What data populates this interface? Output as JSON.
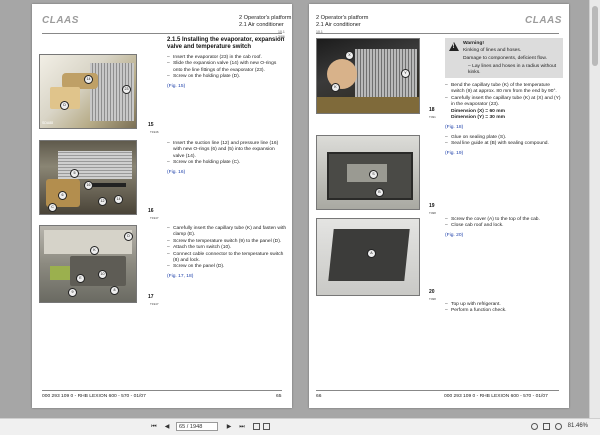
{
  "left_page": {
    "logo": "CLAAS",
    "header_line1": "2 Operator's platform",
    "header_line2": "2.1 Air conditioner",
    "header_small": "10.1",
    "header_small2": "3/86",
    "section_title": "2.1.5 Installing the evaporator, expansion valve and temperature switch",
    "block1": [
      "Insert the evaporator (23) in the cab roof.",
      "Slide the expansion valve (14) with new O-rings onto the line fittings of the evaporator (23).",
      "Screw on the holding plate (D)."
    ],
    "block1_ref": "(Fig. 15)",
    "block2": [
      "Insert the suction line (12) and pressure line (16) with new O-rings (6) and (5) into the expansion valve (14).",
      "Screw on the holding plate (C)."
    ],
    "block2_ref": "(Fig. 16)",
    "block3": [
      "Carefully insert the capillary tube (K) and fasten with clamp (E).",
      "Screw the temperature switch (9) to the panel (D).",
      "Attach the turn switch (10).",
      "Connect cable connector to the temperature switch (8) and lock.",
      "Screw on the panel (D)."
    ],
    "block3_ref": "(Fig. 17, 18)",
    "fig1_no": "15",
    "fig2_no": "16",
    "fig3_no": "17",
    "fig1_code": "T1946",
    "fig2_code": "T1947",
    "fig3_code": "T1947",
    "photo_tag": "SDA88",
    "footer_left": "000 293 109 0 - RHB LEXION 600 - 570 - 01/07",
    "footer_right": "65"
  },
  "right_page": {
    "logo": "CLAAS",
    "header_line1": "2 Operator's platform",
    "header_line2": "2.1 Air conditioner",
    "header_small": "10.1",
    "warning_title": "Warning!",
    "warning_line1": "Kinking of lines and hoses.",
    "warning_line2": "Damage to components, deficient flow.",
    "warning_item": "Lay lines and hoses in a radius without kinks.",
    "block1": [
      "Bend the capillary tube (K) of the temperature switch (9) at approx. 80 mm from the end by 90°.",
      "Carefully insert the capillary tube (K) at (X) and (Y) in the evaporator (23)."
    ],
    "dim_x": "Dimension (X) = 60 mm",
    "dim_y": "Dimension (Y) = 30 mm",
    "block1_ref": "(Fig. 18)",
    "block2": [
      "Glue on sealing plate (S).",
      "Seal line guide at (B) with sealing compound."
    ],
    "block2_ref": "(Fig. 19)",
    "block3": [
      "Screw the cover (A) to the top of the cab.",
      "Close cab roof and lock."
    ],
    "block3_ref": "(Fig. 20)",
    "block4": [
      "Top up with refrigerant.",
      "Perform a function check."
    ],
    "fig1_no": "18",
    "fig2_no": "19",
    "fig3_no": "20",
    "fig1_code": "T491",
    "fig2_code": "T498",
    "fig3_code": "T498",
    "footer_left": "66",
    "footer_right": "000 293 109 0 - RHB LEXION 600 - 570 - 01/07"
  },
  "callouts": {
    "f15": [
      "14",
      "23",
      "D"
    ],
    "f16": [
      "16",
      "12",
      "5",
      "6",
      "14",
      "C"
    ],
    "f17": [
      "D",
      "K",
      "10",
      "E",
      "9",
      "8"
    ],
    "f18": [
      "X",
      "Y",
      "K"
    ],
    "f19": [
      "S",
      "B"
    ],
    "f20": [
      "A"
    ]
  },
  "toolbar": {
    "page_value": "65 / 1948",
    "zoom": "81.46%"
  }
}
